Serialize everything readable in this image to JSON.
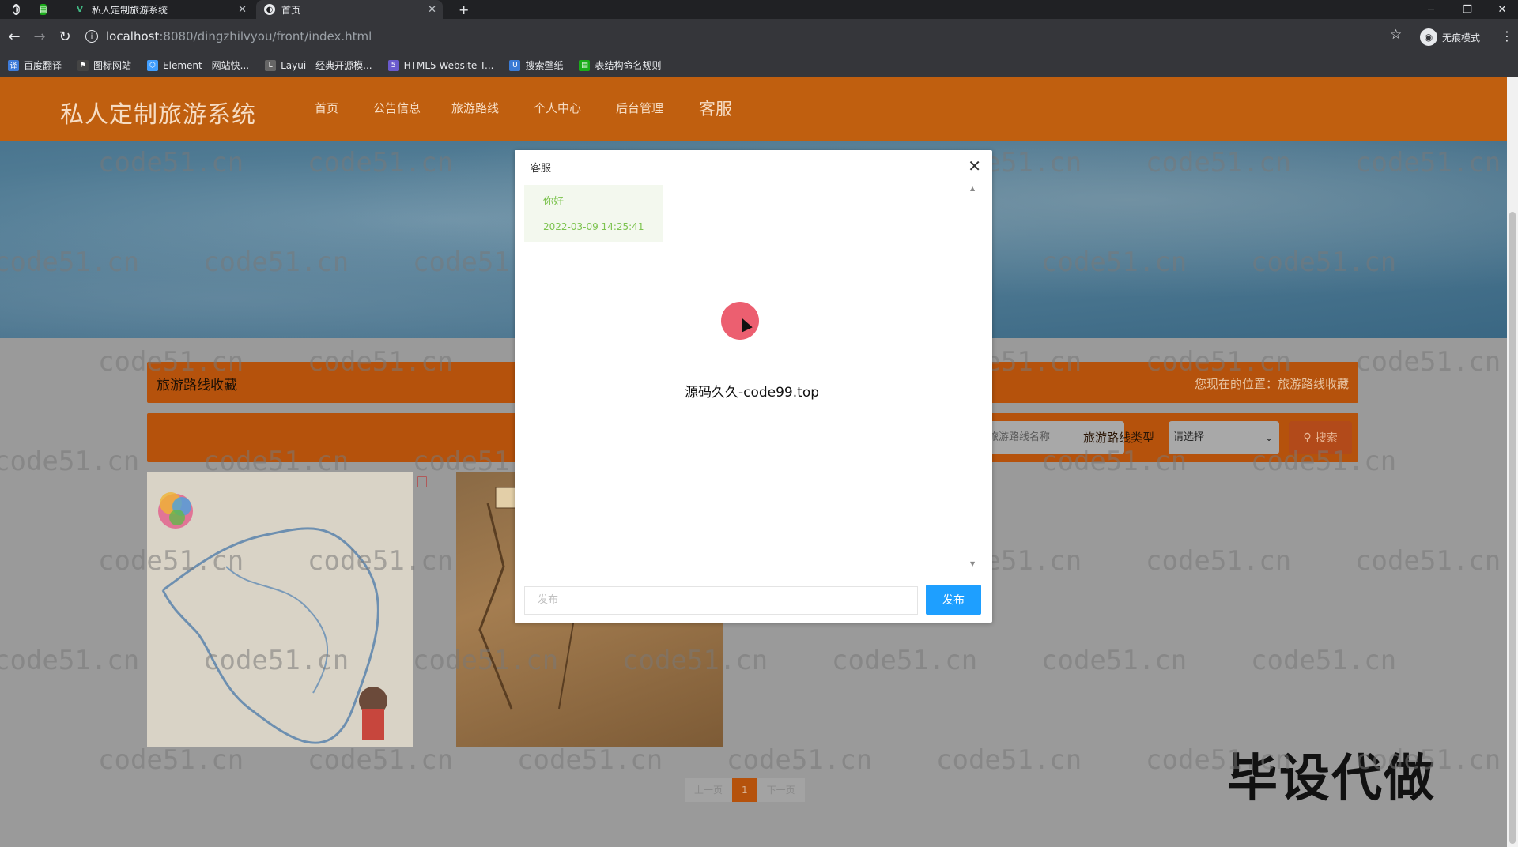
{
  "browser": {
    "tabs": [
      {
        "label": ""
      },
      {
        "label": "私人定制旅游系统"
      },
      {
        "label": "首页"
      }
    ],
    "new_tab": "+",
    "address": {
      "host": "localhost",
      "path": ":8080/dingzhilvyou/front/index.html"
    },
    "incognito_label": "无痕模式",
    "bookmarks": [
      {
        "label": "百度翻译",
        "color": "#3d7bd9"
      },
      {
        "label": "图标网站",
        "color": "#444444"
      },
      {
        "label": "Element - 网站快...",
        "color": "#409eff"
      },
      {
        "label": "Layui - 经典开源模...",
        "color": "#666666"
      },
      {
        "label": "HTML5 Website T...",
        "color": "#6a5acd"
      },
      {
        "label": "搜索壁纸",
        "color": "#3a7bd5"
      },
      {
        "label": "表结构命名规则",
        "color": "#1aad19"
      }
    ]
  },
  "site": {
    "brand": "私人定制旅游系统",
    "menu": [
      "首页",
      "公告信息",
      "旅游路线",
      "个人中心",
      "后台管理",
      "客服"
    ],
    "section_title": "旅游路线收藏",
    "breadcrumb": "您现在的位置：旅游路线收藏",
    "search": {
      "name_placeholder": "旅游路线名称",
      "type_label": "旅游路线类型",
      "type_value": "请选择",
      "button": "搜索"
    },
    "pager": {
      "prev": "上一页",
      "current": "1",
      "next": "下一页"
    },
    "overlay_tag": "毕设代做",
    "watermark": "code51.cn"
  },
  "dialog": {
    "title": "客服",
    "message": {
      "text": "你好",
      "time": "2022-03-09 14:25:41"
    },
    "note": "源码久久-code99.top",
    "input_placeholder": "发布",
    "send_label": "发布"
  },
  "colors": {
    "nav": "#c05f0f",
    "section": "#b5520c",
    "send_button": "#1e9fff",
    "message_green": "#7cc34e"
  }
}
